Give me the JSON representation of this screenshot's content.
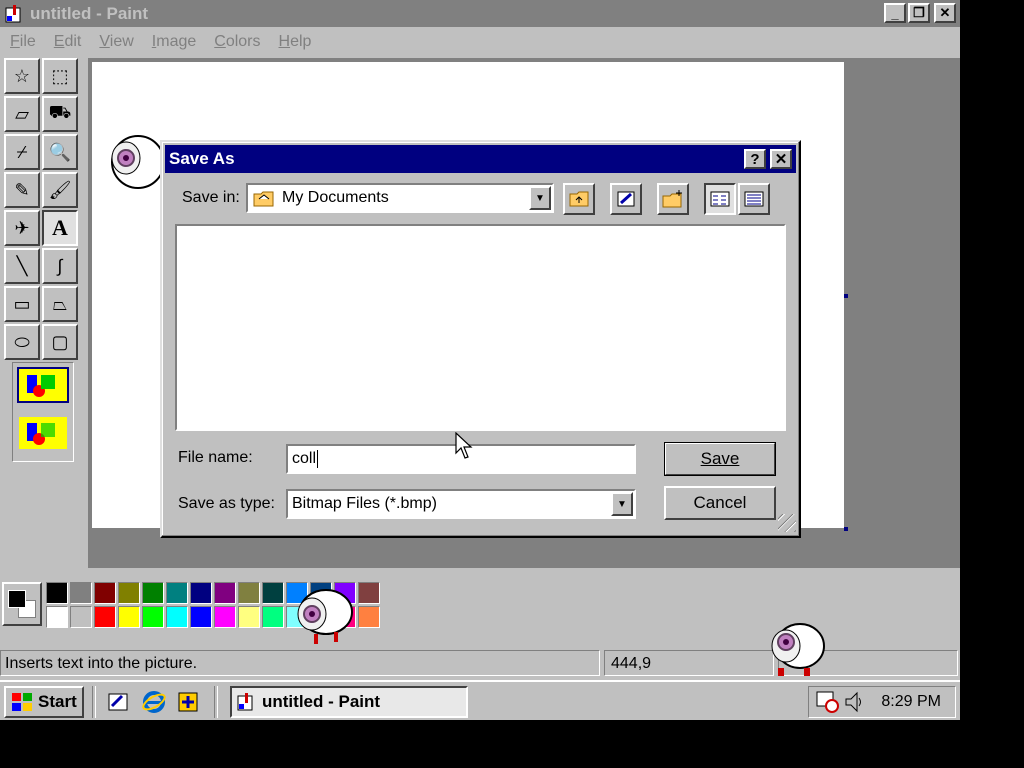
{
  "window": {
    "title": "untitled - Paint",
    "buttons": {
      "minimize": "_",
      "maximize": "❐",
      "close": "✕"
    }
  },
  "menu": [
    "File",
    "Edit",
    "View",
    "Image",
    "Colors",
    "Help"
  ],
  "tools": [
    {
      "name": "free-form-select",
      "glyph": "☆"
    },
    {
      "name": "select",
      "glyph": "⬚"
    },
    {
      "name": "eraser",
      "glyph": "▱"
    },
    {
      "name": "fill-with-color",
      "glyph": "⛟"
    },
    {
      "name": "pick-color",
      "glyph": "⌿"
    },
    {
      "name": "magnifier",
      "glyph": "🔍"
    },
    {
      "name": "pencil",
      "glyph": "✎"
    },
    {
      "name": "brush",
      "glyph": "🖌"
    },
    {
      "name": "airbrush",
      "glyph": "✈"
    },
    {
      "name": "text",
      "glyph": "A"
    },
    {
      "name": "line",
      "glyph": "╲"
    },
    {
      "name": "curve",
      "glyph": "∫"
    },
    {
      "name": "rectangle",
      "glyph": "▭"
    },
    {
      "name": "polygon",
      "glyph": "⏢"
    },
    {
      "name": "ellipse",
      "glyph": "⬭"
    },
    {
      "name": "rounded-rectangle",
      "glyph": "▢"
    }
  ],
  "palette": {
    "foreground": "#000000",
    "background": "#ffffff",
    "top": [
      "#000000",
      "#808080",
      "#800000",
      "#808000",
      "#008000",
      "#008080",
      "#000080",
      "#800080",
      "#808040",
      "#004040",
      "#0080ff",
      "#004080",
      "#8000ff",
      "#804040"
    ],
    "bottom": [
      "#ffffff",
      "#c0c0c0",
      "#ff0000",
      "#ffff00",
      "#00ff00",
      "#00ffff",
      "#0000ff",
      "#ff00ff",
      "#ffff80",
      "#00ff80",
      "#80ffff",
      "#8080ff",
      "#ff0080",
      "#ff8040"
    ]
  },
  "status": {
    "message": "Inserts text into the picture.",
    "coordinates": "444,9"
  },
  "dialog": {
    "title": "Save As",
    "help_btn": "?",
    "close_btn": "✕",
    "save_in_label": "Save in:",
    "save_in_value": "My Documents",
    "file_name_label": "File name:",
    "file_name_value": "coll",
    "save_as_type_label": "Save as type:",
    "save_as_type_value": "Bitmap Files (*.bmp)",
    "save_button": "Save",
    "cancel_button": "Cancel",
    "toolbar": [
      "up-one-level",
      "desktop",
      "new-folder",
      "list-view",
      "details-view"
    ]
  },
  "taskbar": {
    "start": "Start",
    "task": "untitled - Paint",
    "clock": "8:29 PM"
  }
}
